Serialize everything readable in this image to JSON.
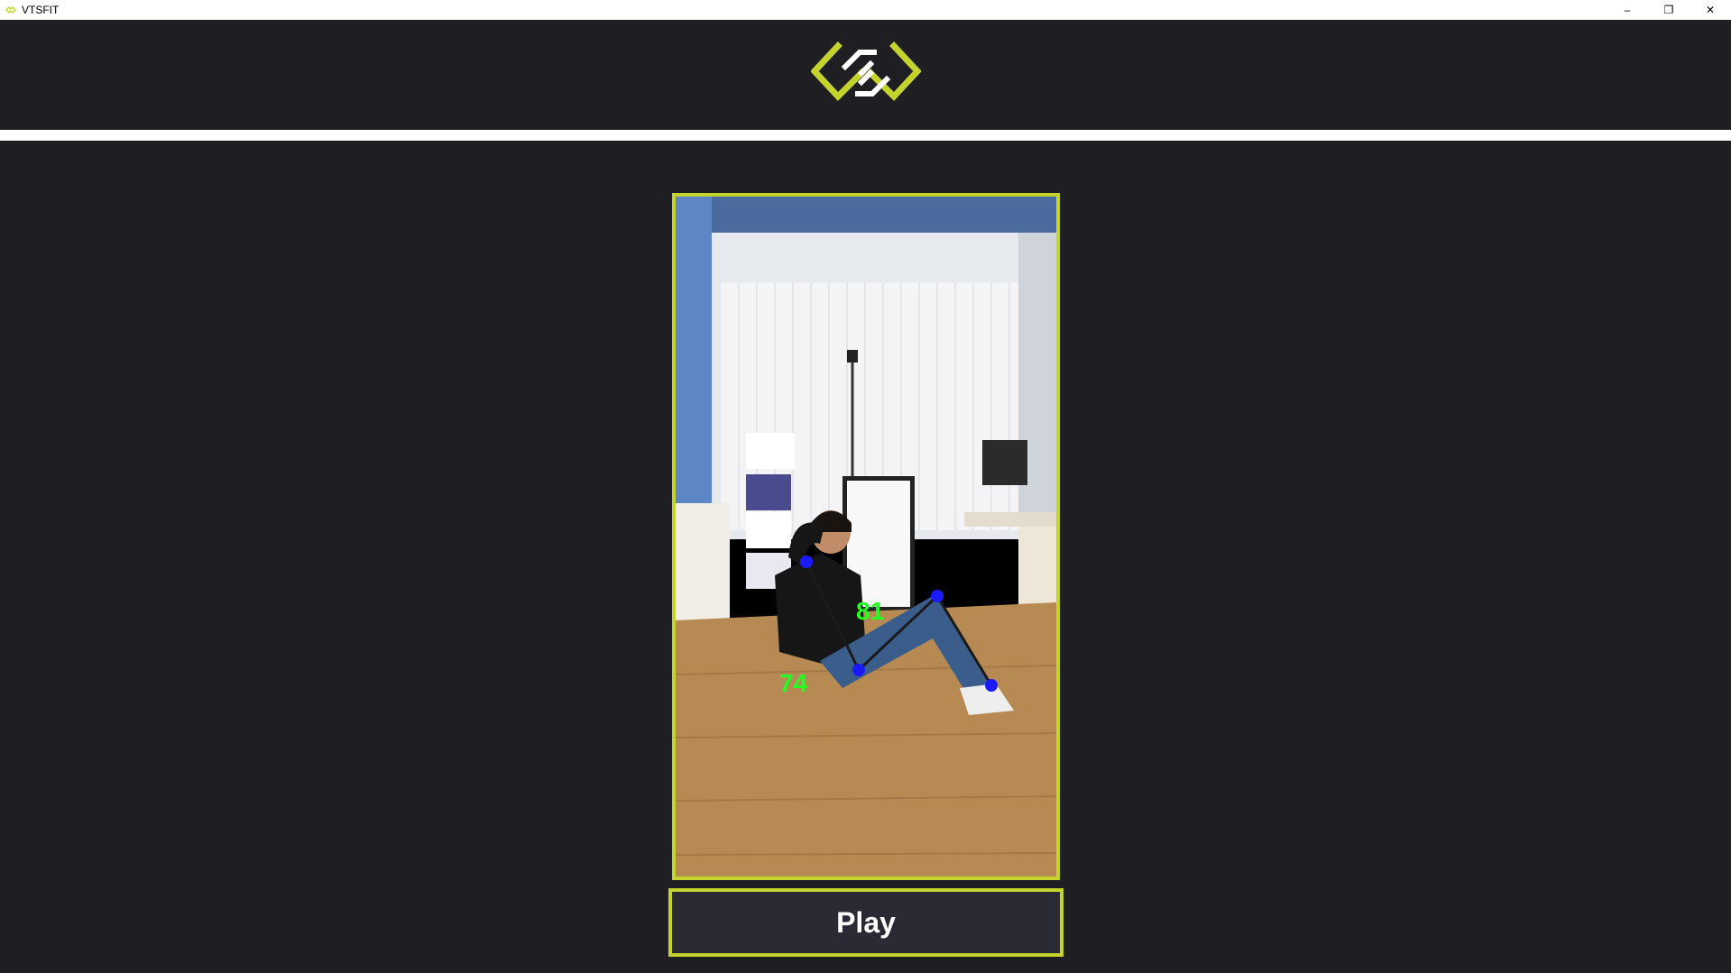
{
  "window": {
    "title": "VTSFIT",
    "controls": {
      "minimize": "–",
      "maximize": "❐",
      "close": "✕"
    }
  },
  "header": {
    "logo_icon": "vts-logo-icon"
  },
  "video": {
    "description_icon": "pose-tracking-video",
    "angles": {
      "hip": "81",
      "knee": "74"
    },
    "accent_color": "#c4d42c",
    "joint_color": "#1a1aff",
    "angle_color": "#22ff22"
  },
  "controls": {
    "play_label": "Play"
  }
}
